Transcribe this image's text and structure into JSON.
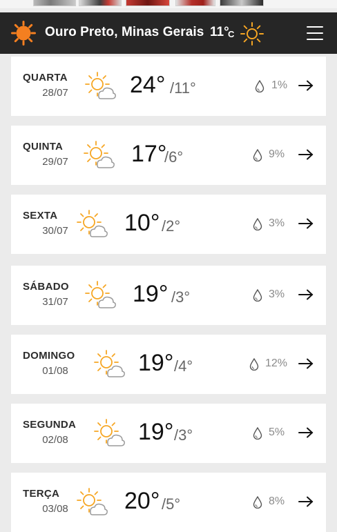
{
  "header": {
    "city": "Ouro Preto, Minas Gerais",
    "current_temp": "11°",
    "unit": "C",
    "icon": "sun-icon",
    "menu_icon": "hamburger-menu-icon"
  },
  "forecast": [
    {
      "day": "QUARTA",
      "date": "28/07",
      "max": "24°",
      "min": "/11°",
      "rain": "1%",
      "icon": "partly-cloudy-icon"
    },
    {
      "day": "QUINTA",
      "date": "29/07",
      "max": "17°",
      "min": "/6°",
      "rain": "9%",
      "icon": "partly-cloudy-icon"
    },
    {
      "day": "SEXTA",
      "date": "30/07",
      "max": "10°",
      "min": "/2°",
      "rain": "3%",
      "icon": "partly-cloudy-icon"
    },
    {
      "day": "SÁBADO",
      "date": "31/07",
      "max": "19°",
      "min": "/3°",
      "rain": "3%",
      "icon": "partly-cloudy-icon"
    },
    {
      "day": "DOMINGO",
      "date": "01/08",
      "max": "19°",
      "min": "/4°",
      "rain": "12%",
      "icon": "partly-cloudy-icon"
    },
    {
      "day": "SEGUNDA",
      "date": "02/08",
      "max": "19°",
      "min": "/3°",
      "rain": "5%",
      "icon": "partly-cloudy-icon"
    },
    {
      "day": "TERÇA",
      "date": "03/08",
      "max": "20°",
      "min": "/5°",
      "rain": "8%",
      "icon": "partly-cloudy-icon"
    }
  ],
  "colors": {
    "header_bg": "#262626",
    "sun_orange": "#f47f20",
    "sun_yellow": "#f6a623",
    "page_bg": "#ebebeb",
    "card_bg": "#ffffff"
  }
}
